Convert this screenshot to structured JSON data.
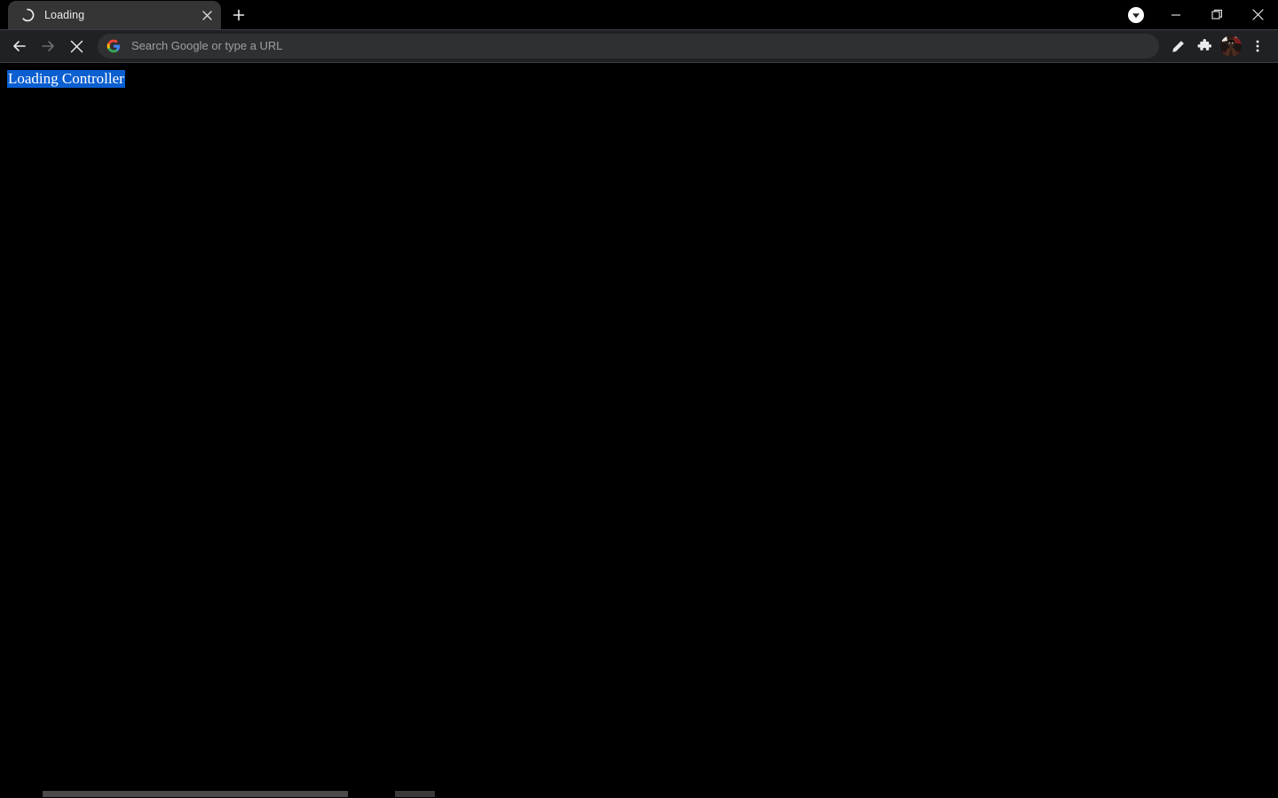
{
  "window": {
    "background_color": "#000000",
    "tabstrip_color": "#000000",
    "toolbar_color": "#202124",
    "accent_selection_color": "#0b5fd0",
    "controls": [
      {
        "name": "minimize",
        "label": "Minimize"
      },
      {
        "name": "maximize",
        "label": "Maximize"
      },
      {
        "name": "close",
        "label": "Close"
      }
    ],
    "download_indicator": {
      "icon": "download-circle-icon",
      "label": "Downloads"
    }
  },
  "tabstrip": {
    "tabs": [
      {
        "title": "Loading",
        "loading": true,
        "active": true,
        "throbber_icon": "loading-spinner-icon",
        "close_icon": "close-icon",
        "close_label": "Close tab"
      }
    ],
    "new_tab": {
      "icon": "plus-icon",
      "label": "New tab"
    }
  },
  "toolbar": {
    "back": {
      "icon": "arrow-left-icon",
      "label": "Back",
      "enabled": true
    },
    "forward": {
      "icon": "arrow-right-icon",
      "label": "Forward",
      "enabled": false
    },
    "stop": {
      "icon": "close-icon",
      "label": "Stop loading this page"
    },
    "omnibox": {
      "icon": "google-g-icon",
      "placeholder": "Search Google or type a URL",
      "value": ""
    },
    "actions": [
      {
        "name": "edit-pencil",
        "icon": "pencil-icon",
        "label": "Edit"
      },
      {
        "name": "extensions",
        "icon": "puzzle-piece-icon",
        "label": "Extensions"
      },
      {
        "name": "profile",
        "icon": "avatar-icon",
        "label": "Profile"
      },
      {
        "name": "chrome-menu",
        "icon": "three-dot-menu-icon",
        "label": "Customize and control"
      }
    ]
  },
  "page": {
    "background_color": "#000000",
    "heading": "Loading Controller",
    "heading_selected": true,
    "selection_color": "#0b5fd0",
    "selection_text_color": "#ffffff"
  },
  "scrollbar": {
    "orientation": "horizontal",
    "visible": true,
    "thumb_color": "#4a4a4a",
    "track_color": "#000000"
  }
}
